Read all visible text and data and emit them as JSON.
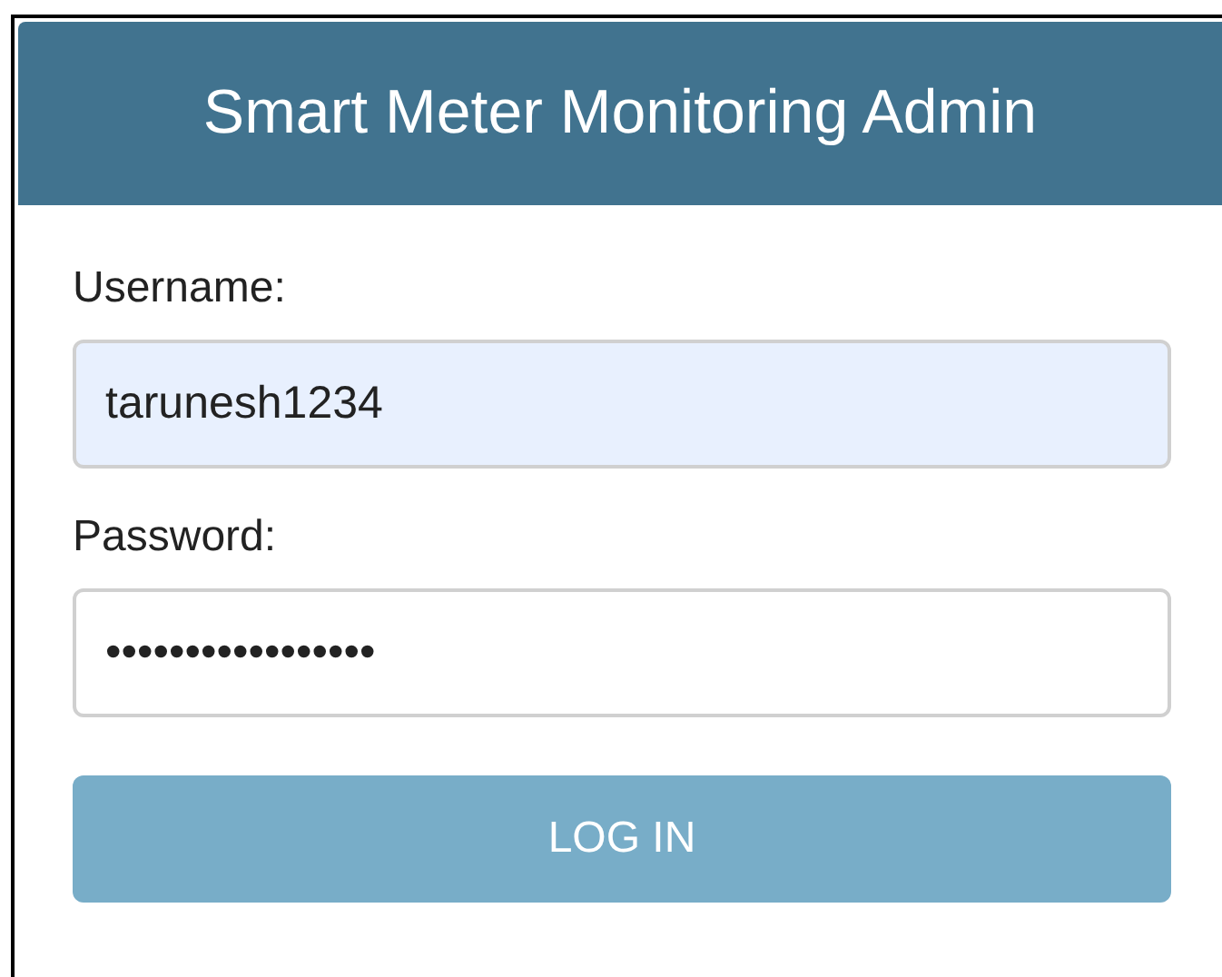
{
  "header": {
    "title": "Smart Meter Monitoring Admin"
  },
  "fields": [
    {
      "label": "Username:",
      "value": "tarunesh1234",
      "autofilled": true
    },
    {
      "label": "Password:",
      "value": "•••••••••••••••••",
      "autofilled": false
    }
  ],
  "button": {
    "label": "LOG IN",
    "disabled": true
  }
}
